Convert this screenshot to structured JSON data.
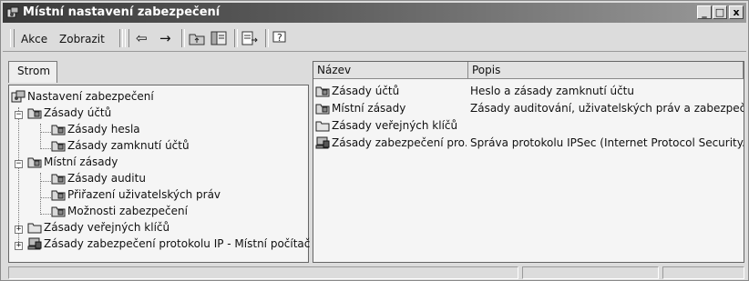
{
  "window": {
    "title": "Místní nastavení zabezpečení",
    "minimize_label": "_",
    "maximize_label": "□",
    "close_label": "x"
  },
  "toolbar": {
    "menu_action": "Akce",
    "menu_view": "Zobrazit",
    "back_label": "⇦",
    "forward_label": "→"
  },
  "left_pane": {
    "tab_label": "Strom",
    "tree": [
      {
        "label": "Nastavení zabezpečení",
        "icon": "security-settings-icon"
      },
      {
        "label": "Zásady účtů",
        "icon": "folder-icon",
        "expander": "−"
      },
      {
        "label": "Zásady hesla",
        "icon": "folder-icon"
      },
      {
        "label": "Zásady zamknutí účtů",
        "icon": "folder-icon"
      },
      {
        "label": "Místní zásady",
        "icon": "folder-icon",
        "expander": "−"
      },
      {
        "label": "Zásady auditu",
        "icon": "folder-icon"
      },
      {
        "label": "Přiřazení uživatelských práv",
        "icon": "folder-icon"
      },
      {
        "label": "Možnosti zabezpečení",
        "icon": "folder-icon"
      },
      {
        "label": "Zásady veřejných klíčů",
        "icon": "plain-folder-icon",
        "expander": "+"
      },
      {
        "label": "Zásady zabezpečení protokolu IP - Místní počítač",
        "icon": "ipsec-computer-icon",
        "expander": "+"
      }
    ]
  },
  "right_pane": {
    "columns": [
      "Název",
      "Popis"
    ],
    "rows": [
      {
        "name": "Zásady účtů",
        "description": "Heslo a zásady zamknutí účtu",
        "icon": "folder-icon"
      },
      {
        "name": "Místní zásady",
        "description": "Zásady auditování, uživatelských práv a zabezpečení",
        "icon": "folder-icon"
      },
      {
        "name": "Zásady veřejných klíčů",
        "description": "",
        "icon": "plain-folder-icon"
      },
      {
        "name": "Zásady zabezpečení pro...",
        "description": "Správa protokolu IPSec (Internet Protocol Security...",
        "icon": "ipsec-computer-icon"
      }
    ]
  }
}
